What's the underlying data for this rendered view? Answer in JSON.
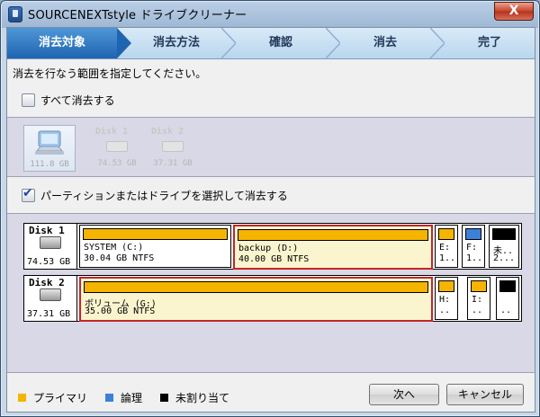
{
  "window": {
    "title": "SOURCENEXTstyle ドライブクリーナー",
    "close": "X"
  },
  "steps": [
    {
      "label": "消去対象"
    },
    {
      "label": "消去方法"
    },
    {
      "label": "確認"
    },
    {
      "label": "消去"
    },
    {
      "label": "完了"
    }
  ],
  "instruction": "消去を行なう範囲を指定してください。",
  "erase_all_label": "すべて消去する",
  "disk_select": [
    {
      "name": "",
      "size": "111.8 GB"
    },
    {
      "name": "Disk 1",
      "size": "74.53 GB"
    },
    {
      "name": "Disk 2",
      "size": "37.31 GB"
    }
  ],
  "partition_mode_label": "パーティションまたはドライブを選択して消去する",
  "disks": [
    {
      "name": "Disk 1",
      "size": "74.53 GB",
      "partitions": [
        {
          "line1": "SYSTEM (C:)",
          "line2": "30.04 GB NTFS",
          "color": "#f5b400"
        },
        {
          "line1": "backup (D:)",
          "line2": "40.00 GB NTFS",
          "color": "#f5b400"
        },
        {
          "line1": "E:",
          "line2": "1..",
          "color": "#f5b400"
        },
        {
          "line1": "F:",
          "line2": "1..",
          "color": "#3d80d8"
        },
        {
          "line1": "未..",
          "line2": "2...",
          "color": "#000000"
        }
      ]
    },
    {
      "name": "Disk 2",
      "size": "37.31 GB",
      "partitions": [
        {
          "line1": "ボリューム (G:)",
          "line2": "35.00 GB NTFS",
          "color": "#f5b400"
        },
        {
          "line1": "H:",
          "line2": "..",
          "color": "#f5b400"
        },
        {
          "line1": "I:",
          "line2": "..",
          "color": "#f5b400"
        },
        {
          "line1": "",
          "line2": "..",
          "color": "#000000"
        }
      ]
    }
  ],
  "legend": [
    {
      "label": "プライマリ",
      "color": "#f5b400"
    },
    {
      "label": "論理",
      "color": "#3d80d8"
    },
    {
      "label": "未割り当て",
      "color": "#000000"
    }
  ],
  "buttons": {
    "next": "次へ",
    "cancel": "キャンセル"
  }
}
